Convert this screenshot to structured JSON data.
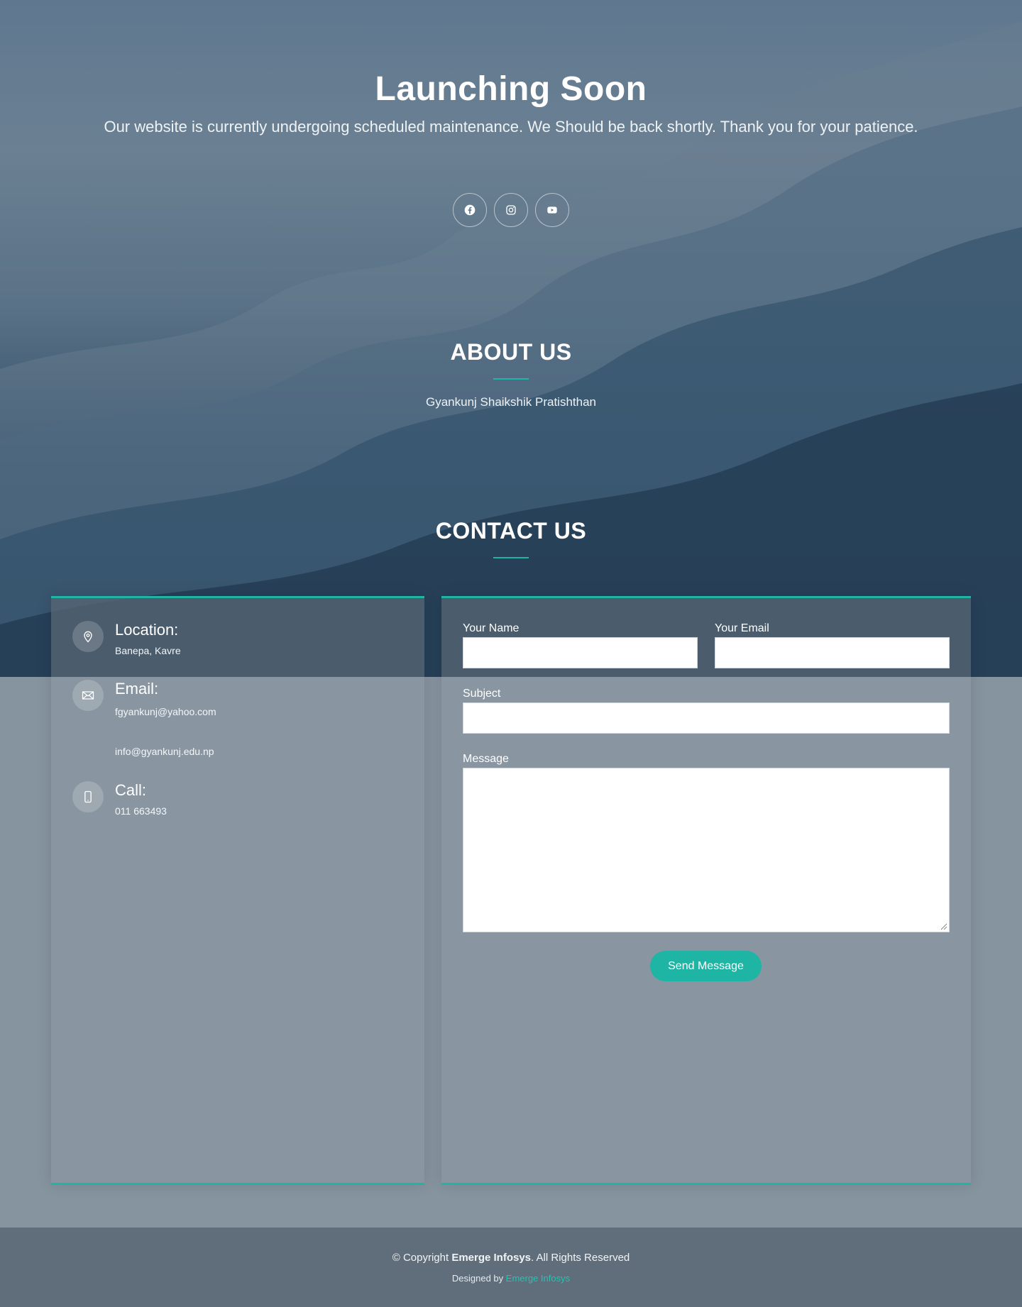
{
  "hero": {
    "title": "Launching Soon",
    "subtitle": "Our website is currently undergoing scheduled maintenance. We Should be back shortly. Thank you for your patience."
  },
  "social": [
    {
      "icon": "facebook-icon"
    },
    {
      "icon": "instagram-icon"
    },
    {
      "icon": "youtube-icon"
    }
  ],
  "about": {
    "title": "ABOUT US",
    "text": "Gyankunj Shaikshik Pratishthan"
  },
  "contact": {
    "title": "CONTACT US",
    "location": {
      "label": "Location:",
      "value": "Banepa, Kavre"
    },
    "email": {
      "label": "Email:",
      "values": [
        "fgyankunj@yahoo.com",
        "info@gyankunj.edu.np"
      ]
    },
    "call": {
      "label": "Call:",
      "value": "011 663493"
    }
  },
  "form": {
    "name_label": "Your Name",
    "email_label": "Your Email",
    "subject_label": "Subject",
    "message_label": "Message",
    "name_value": "",
    "email_value": "",
    "subject_value": "",
    "message_value": "",
    "send_label": "Send Message"
  },
  "footer": {
    "copyright_prefix": "© Copyright ",
    "company": "Emerge Infosys",
    "rights": ". All Rights Reserved",
    "designed_by": "Designed by ",
    "designer": "Emerge Infosys"
  },
  "colors": {
    "accent": "#1fb5a5"
  }
}
